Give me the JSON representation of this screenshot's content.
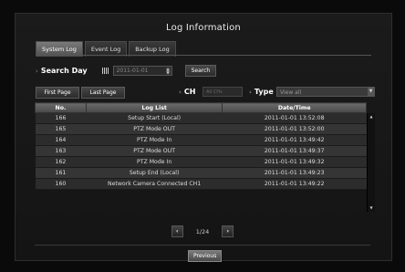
{
  "window": {
    "title": "Log Information"
  },
  "tabs": [
    {
      "label": "System Log",
      "active": true
    },
    {
      "label": "Event Log",
      "active": false
    },
    {
      "label": "Backup Log",
      "active": false
    }
  ],
  "search": {
    "label": "Search Day",
    "date_value": "2011-01-01",
    "button_label": "Search"
  },
  "nav": {
    "first_label": "First Page",
    "last_label": "Last Page",
    "ch_label": "CH",
    "ch_placeholder": "All CHs",
    "type_label": "Type",
    "type_value": "View all"
  },
  "table": {
    "headers": [
      "No.",
      "Log List",
      "Date/Time"
    ],
    "rows": [
      [
        "166",
        "Setup Start (Local)",
        "2011-01-01 13:52:08"
      ],
      [
        "165",
        "PTZ Mode OUT",
        "2011-01-01 13:52:00"
      ],
      [
        "164",
        "PTZ Mode In",
        "2011-01-01 13:49:42"
      ],
      [
        "163",
        "PTZ Mode OUT",
        "2011-01-01 13:49:37"
      ],
      [
        "162",
        "PTZ Mode In",
        "2011-01-01 13:49:32"
      ],
      [
        "161",
        "Setup End (Local)",
        "2011-01-01 13:49:23"
      ],
      [
        "160",
        "Network Camera Connected CH1",
        "2011-01-01 13:49:22"
      ]
    ]
  },
  "pager": {
    "info": "1/24",
    "prev_icon": "‹",
    "next_icon": "›"
  },
  "footer": {
    "previous_label": "Previous"
  },
  "colors": {
    "background": "#0a0a0a",
    "header": "#5a5a5a",
    "active_tab": "#6a6a6a"
  }
}
